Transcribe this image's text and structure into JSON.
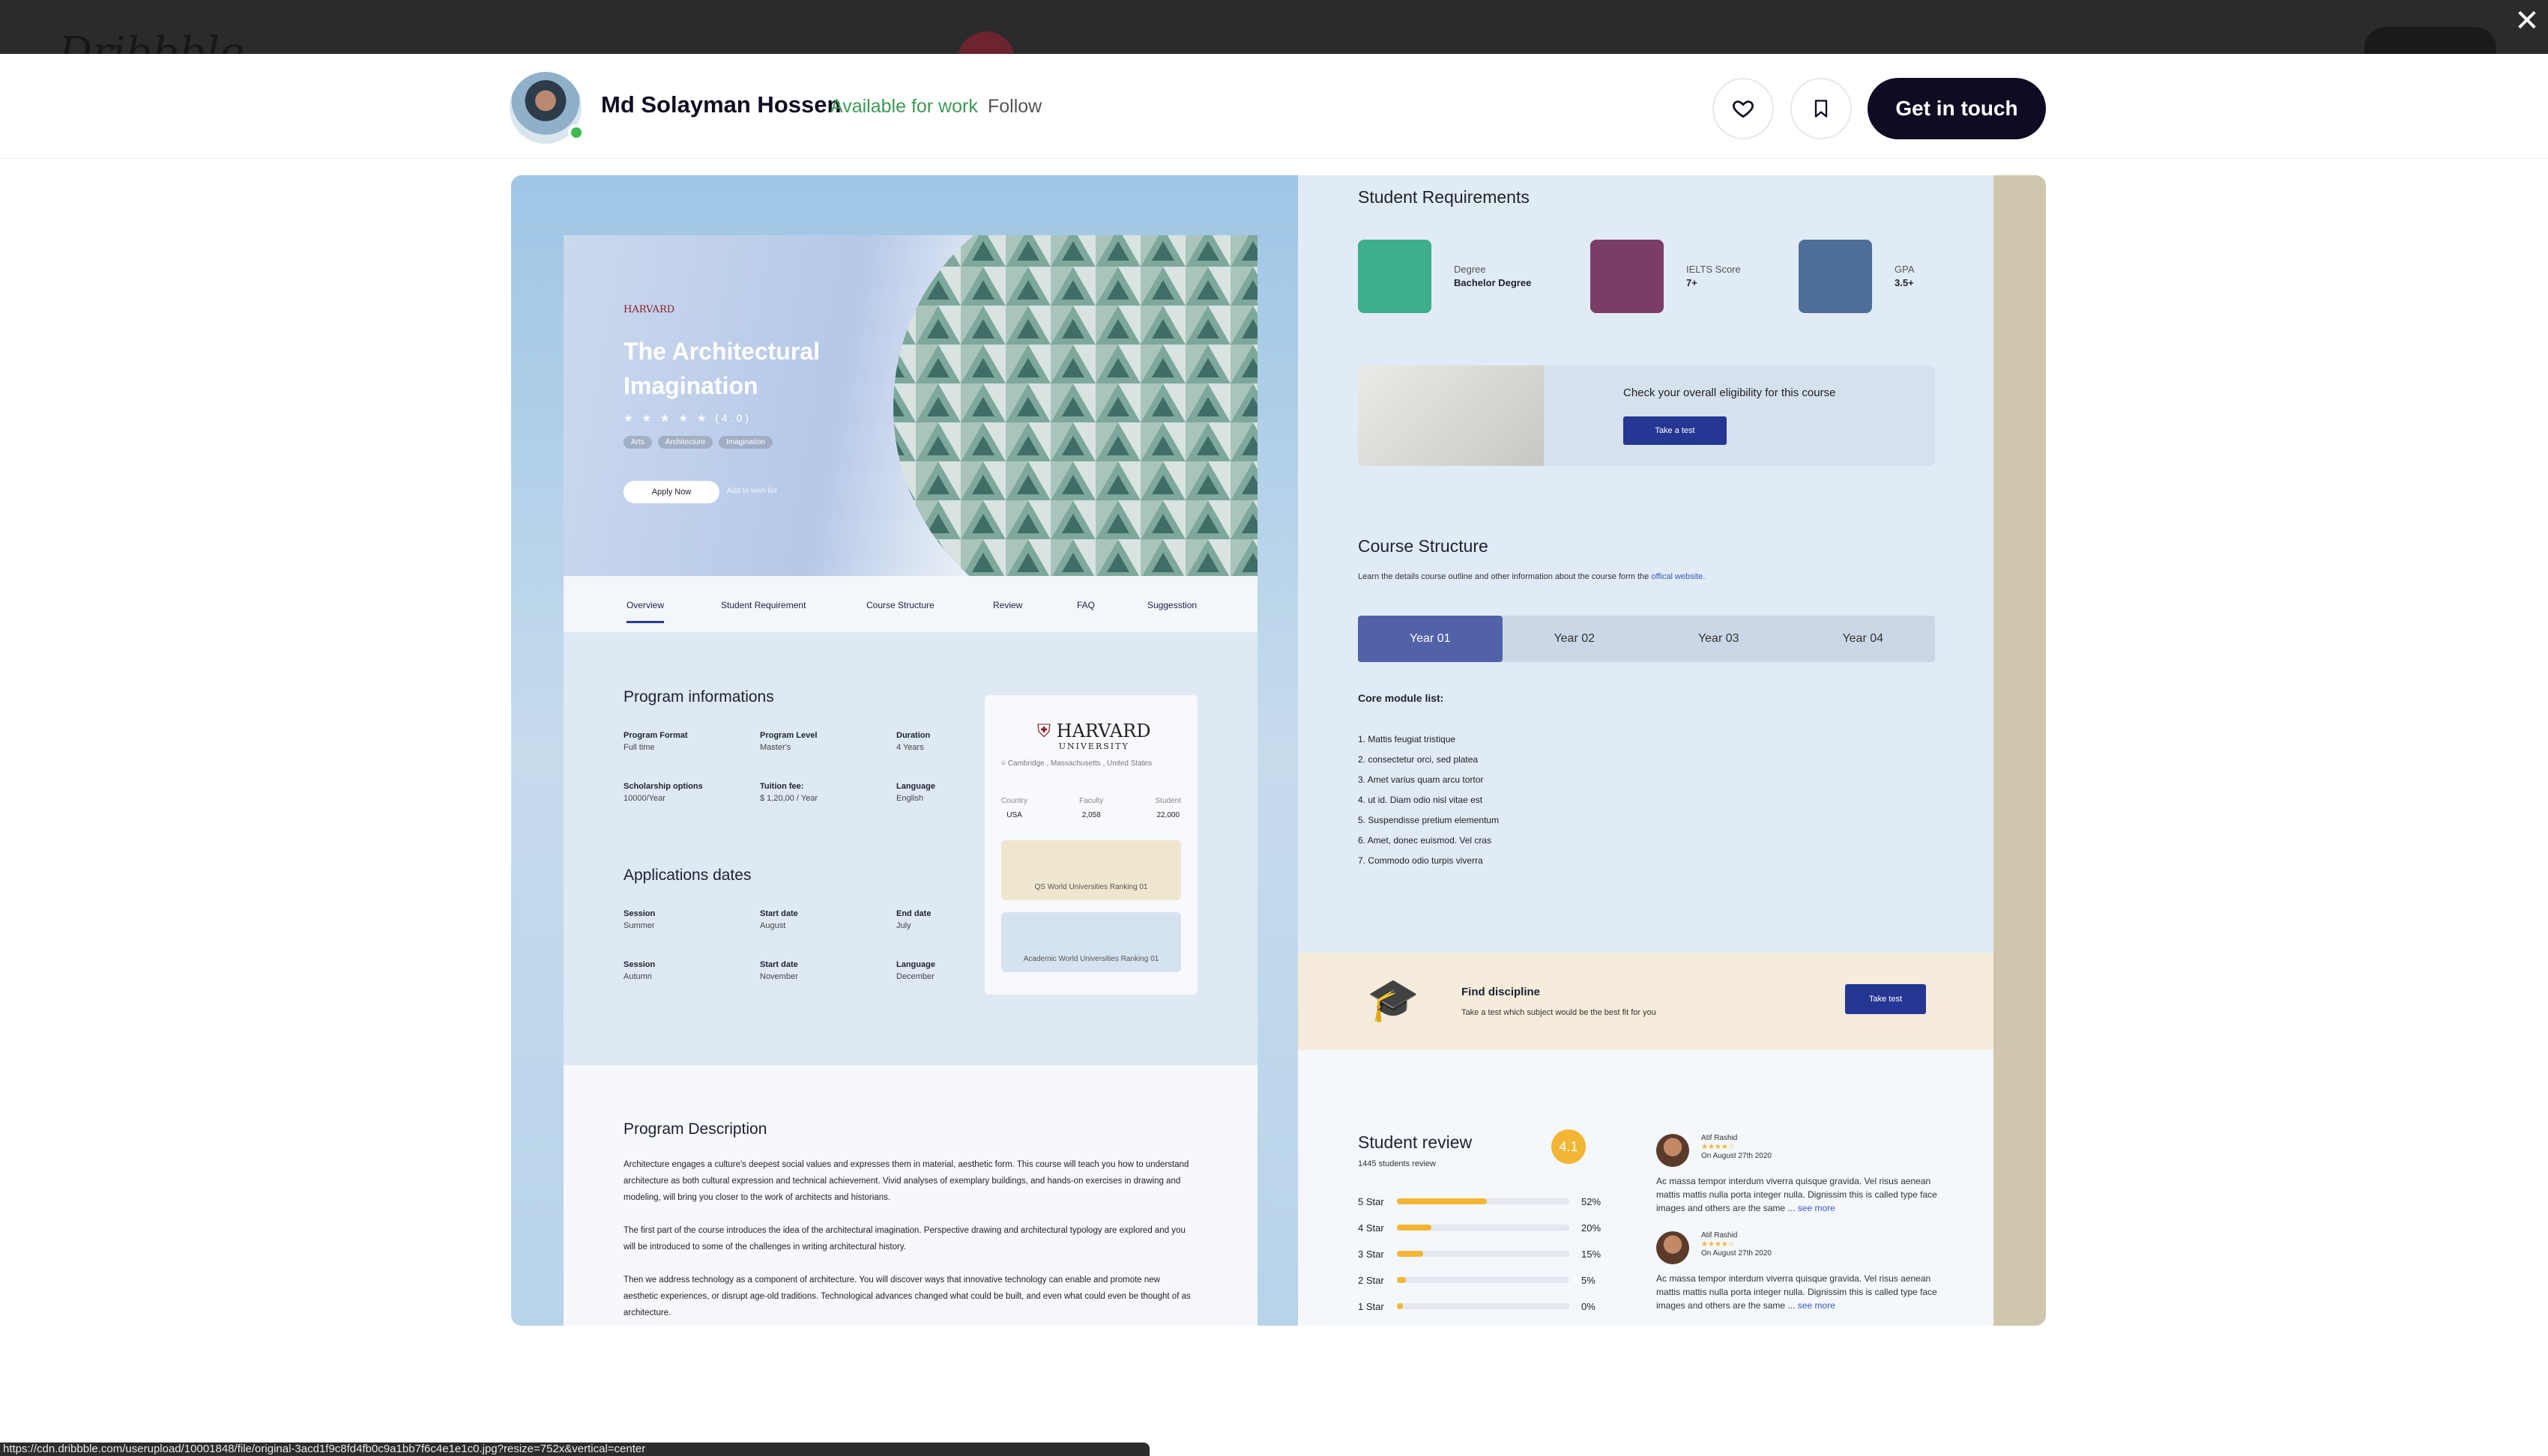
{
  "window": {
    "close_symbol": "✕",
    "url_text": "https://cdn.dribbble.com/userupload/10001848/file/original-3acd1f9c8fd4fb0c9a1bb7f6c4e1e1c0.jpg?resize=752x&vertical=center"
  },
  "header": {
    "author_name": "Md Solayman Hossen",
    "availability": "Available for work",
    "follow_label": "Follow",
    "cta_label": "Get in touch"
  },
  "shot": {
    "hero": {
      "university_mini": "HARVARD",
      "title": "The Architectural Imagination",
      "stars": "★ ★ ★ ★ ★",
      "rating": "(4.0)",
      "chips": [
        "Arts",
        "Architecture",
        "Imagination"
      ],
      "apply_label": "Apply Now",
      "wishlist_label": "Add to wish list"
    },
    "tabs": [
      "Overview",
      "Student Requirement",
      "Course Structure",
      "Review",
      "FAQ",
      "Suggesstion"
    ],
    "program_info": {
      "title": "Program informations",
      "rows": [
        [
          {
            "k": "Program Format",
            "v": "Full time"
          },
          {
            "k": "Program Level",
            "v": "Master's"
          },
          {
            "k": "Duration",
            "v": "4 Years"
          }
        ],
        [
          {
            "k": "Scholarship options",
            "v": "10000/Year"
          },
          {
            "k": "Tuition fee:",
            "v": "$ 1,20,00 / Year"
          },
          {
            "k": "Language",
            "v": "English"
          }
        ]
      ]
    },
    "application_dates": {
      "title": "Applications dates",
      "rows": [
        [
          {
            "k": "Session",
            "v": "Summer"
          },
          {
            "k": "Start date",
            "v": "August"
          },
          {
            "k": "End date",
            "v": "July"
          }
        ],
        [
          {
            "k": "Session",
            "v": "Autumn"
          },
          {
            "k": "Start date",
            "v": "November"
          },
          {
            "k": "Language",
            "v": "December"
          }
        ]
      ]
    },
    "harvard_card": {
      "name": "HARVARD",
      "sub": "UNIVERSITY",
      "location": "Cambridge , Massachusetts , United States",
      "stats": [
        {
          "k": "Country",
          "v": "USA"
        },
        {
          "k": "Faculty",
          "v": "2,058"
        },
        {
          "k": "Student",
          "v": "22,000"
        }
      ],
      "rank1": "QS World Universities Ranking   01",
      "rank2": "Academic World Universities Ranking   01"
    },
    "description": {
      "title": "Program Description",
      "p1": "Architecture engages a culture's deepest social values and expresses them in material, aesthetic form. This course will teach you how to understand architecture as both cultural expression and technical achievement. Vivid analyses of exemplary buildings, and hands-on exercises in drawing and modeling, will bring you closer to the work of architects and historians.",
      "p2": "The first part of the course introduces the idea of the architectural imagination. Perspective drawing and architectural typology are explored and you will be introduced to some of the challenges in writing architectural history.",
      "p3": "Then we address technology as a component of architecture. You will discover ways that innovative technology can enable and promote new aesthetic experiences, or disrupt age-old traditions. Technological advances changed what could be built, and even what could even be thought of as architecture."
    },
    "requirements": {
      "title": "Student Requirements",
      "items": [
        {
          "k": "Degree",
          "v": "Bachelor Degree"
        },
        {
          "k": "IELTS Score",
          "v": "7+"
        },
        {
          "k": "GPA",
          "v": "3.5+"
        }
      ]
    },
    "eligibility": {
      "text": "Check your overall eligibility for this course",
      "button": "Take a test"
    },
    "course_structure": {
      "title": "Course Structure",
      "subtitle": "Learn the details course outline and other information about the course form the",
      "link": "offical website.",
      "years": [
        "Year 01",
        "Year 02",
        "Year 03",
        "Year 04"
      ],
      "core_title": "Core module list:",
      "modules": [
        "1. Mattis feugiat tristique",
        "2. consectetur orci, sed platea",
        "3. Amet varius quam arcu tortor",
        "4.  ut id. Diam odio nisl vitae est",
        "5. Suspendisse pretium elementum",
        "6. Amet, donec euismod. Vel cras",
        "7. Commodo odio turpis viverra"
      ]
    },
    "discipline": {
      "title": "Find discipline",
      "subtitle": "Take a test which subject would be the best fit for you",
      "button": "Take test"
    },
    "review": {
      "title": "Student review",
      "count": "1445 students review",
      "score": "4.1",
      "bars": [
        {
          "label": "5 Star",
          "pct": "52%",
          "value": 52
        },
        {
          "label": "4 Star",
          "pct": "20%",
          "value": 20
        },
        {
          "label": "3 Star",
          "pct": "15%",
          "value": 15
        },
        {
          "label": "2 Star",
          "pct": "5%",
          "value": 5
        },
        {
          "label": "1 Star",
          "pct": "0%",
          "value": 0
        }
      ],
      "reviews": [
        {
          "name": "Atif Rashid",
          "date": "On August 27th 2020",
          "text": "Ac massa tempor interdum viverra quisque gravida. Vel risus aenean mattis mattis nulla porta integer nulla. Dignissim this is called type face images and others are the same ...",
          "more": "see more"
        },
        {
          "name": "Atif Rashid",
          "date": "On August 27th 2020",
          "text": "Ac massa tempor interdum viverra quisque gravida. Vel risus aenean mattis mattis nulla porta integer nulla. Dignissim this is called type face images and others are the same ...",
          "more": "see more"
        }
      ]
    }
  },
  "colors": {
    "accent": "#0d0c22",
    "available": "#3d9a55",
    "navy": "#253693",
    "star": "#f2b534"
  }
}
